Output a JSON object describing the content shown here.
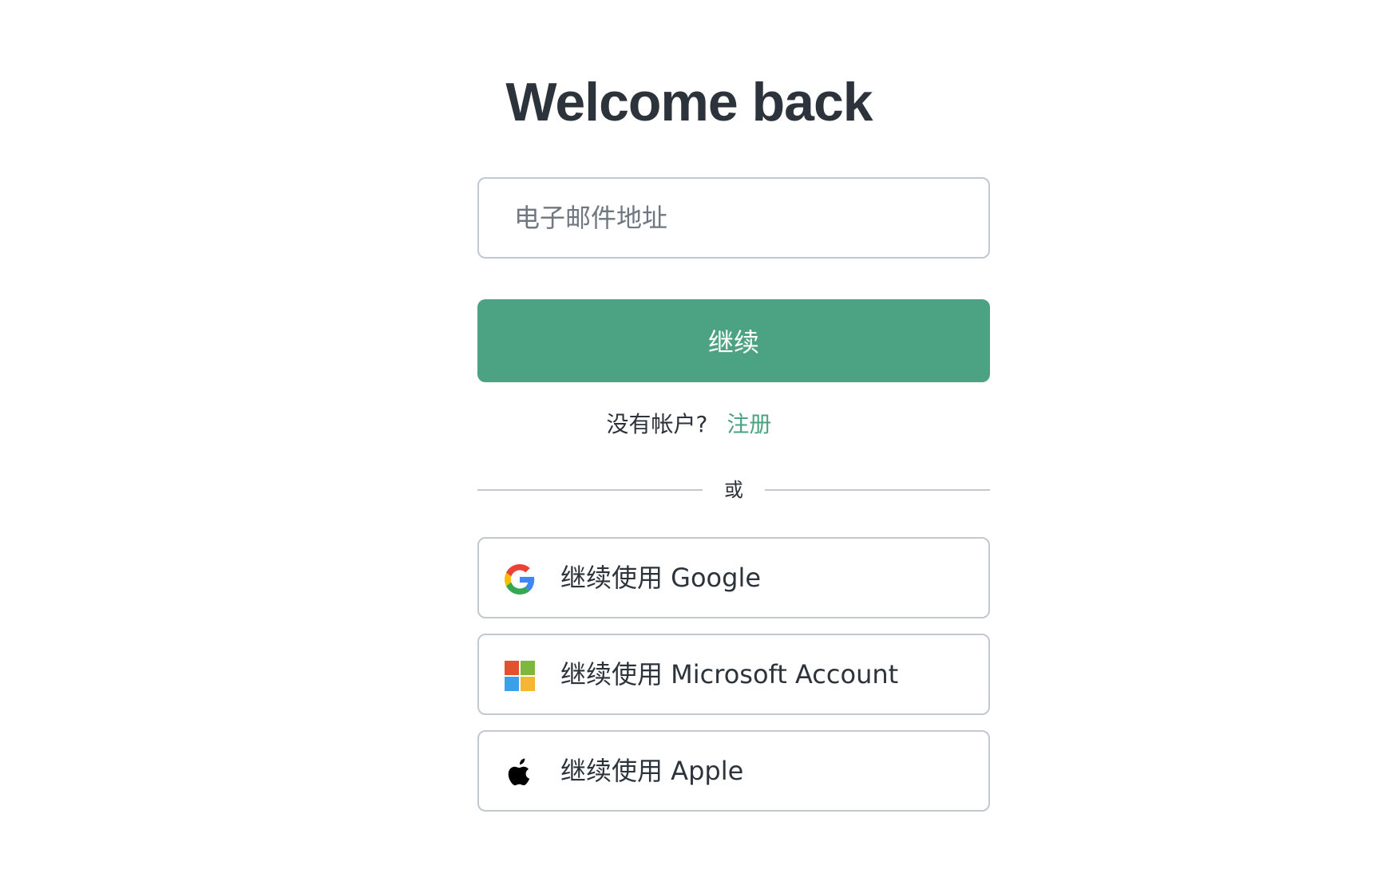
{
  "header": {
    "title": "Welcome back"
  },
  "form": {
    "email_placeholder": "电子邮件地址",
    "email_value": "",
    "continue_label": "继续"
  },
  "signup": {
    "prompt": "没有帐户?",
    "link_label": "注册"
  },
  "divider": {
    "label": "或"
  },
  "social_logins": [
    {
      "label": "继续使用 Google",
      "icon": "google-icon"
    },
    {
      "label": "继续使用 Microsoft Account",
      "icon": "microsoft-icon"
    },
    {
      "label": "继续使用 Apple",
      "icon": "apple-icon"
    }
  ],
  "colors": {
    "accent": "#4ba383",
    "text": "#2d333a",
    "border": "#c2c8d0",
    "placeholder": "#6f7780",
    "background": "#ffffff"
  }
}
